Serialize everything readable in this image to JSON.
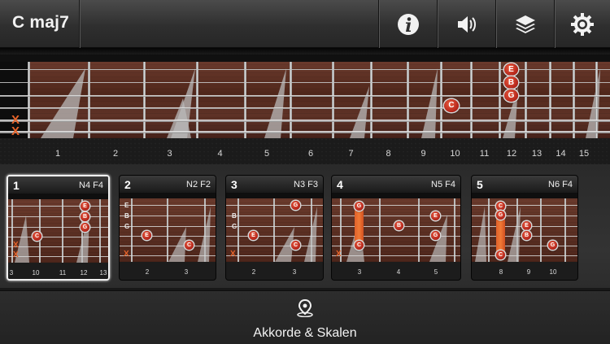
{
  "header": {
    "title": "C maj7"
  },
  "toolbar": {
    "info_icon": "info-icon",
    "sound_icon": "speaker-icon",
    "layers_icon": "layers-icon",
    "settings_icon": "gear-icon"
  },
  "main_fretboard": {
    "muted_strings": [
      "X",
      "X"
    ],
    "fret_numbers": [
      "1",
      "2",
      "3",
      "4",
      "5",
      "6",
      "7",
      "8",
      "9",
      "10",
      "11",
      "12",
      "13",
      "14",
      "15"
    ],
    "notes": [
      {
        "label": "E",
        "fret": 12,
        "string": 1
      },
      {
        "label": "B",
        "fret": 12,
        "string": 2
      },
      {
        "label": "G",
        "fret": 12,
        "string": 3
      },
      {
        "label": "C",
        "fret": 10,
        "string": 5
      }
    ],
    "colors": {
      "note": "#c0281c",
      "muted": "#e8642a",
      "wood": "#5a2e22"
    }
  },
  "chord_cards": [
    {
      "number": "1",
      "label": "N4 F4",
      "selected": true,
      "fret_numbers": [
        "3",
        "10",
        "11",
        "12",
        "13"
      ],
      "notes": [
        {
          "label": "E"
        },
        {
          "label": "B"
        },
        {
          "label": "G"
        },
        {
          "label": "C"
        }
      ],
      "muted": [
        "X",
        "X"
      ]
    },
    {
      "number": "2",
      "label": "N2 F2",
      "selected": false,
      "fret_numbers": [
        "2",
        "3"
      ],
      "open": [
        "E",
        "B",
        "G"
      ],
      "notes": [
        {
          "label": "E"
        },
        {
          "label": "C"
        }
      ],
      "muted": [
        "X"
      ]
    },
    {
      "number": "3",
      "label": "N3 F3",
      "selected": false,
      "fret_numbers": [
        "2",
        "3"
      ],
      "open": [
        "B",
        "G"
      ],
      "notes": [
        {
          "label": "G"
        },
        {
          "label": "E"
        },
        {
          "label": "C"
        }
      ],
      "muted": [
        "X"
      ]
    },
    {
      "number": "4",
      "label": "N5 F4",
      "selected": false,
      "fret_numbers": [
        "3",
        "4",
        "5"
      ],
      "notes": [
        {
          "label": "G"
        },
        {
          "label": "C"
        },
        {
          "label": "B"
        },
        {
          "label": "E"
        },
        {
          "label": "G"
        }
      ],
      "muted": [
        "X"
      ]
    },
    {
      "number": "5",
      "label": "N6 F4",
      "selected": false,
      "fret_numbers": [
        "8",
        "9",
        "10"
      ],
      "notes": [
        {
          "label": "C"
        },
        {
          "label": "G"
        },
        {
          "label": "E"
        },
        {
          "label": "B"
        },
        {
          "label": "G"
        },
        {
          "label": "C"
        }
      ]
    }
  ],
  "bottom": {
    "label": "Akkorde & Skalen",
    "icon": "map-pin-icon"
  }
}
